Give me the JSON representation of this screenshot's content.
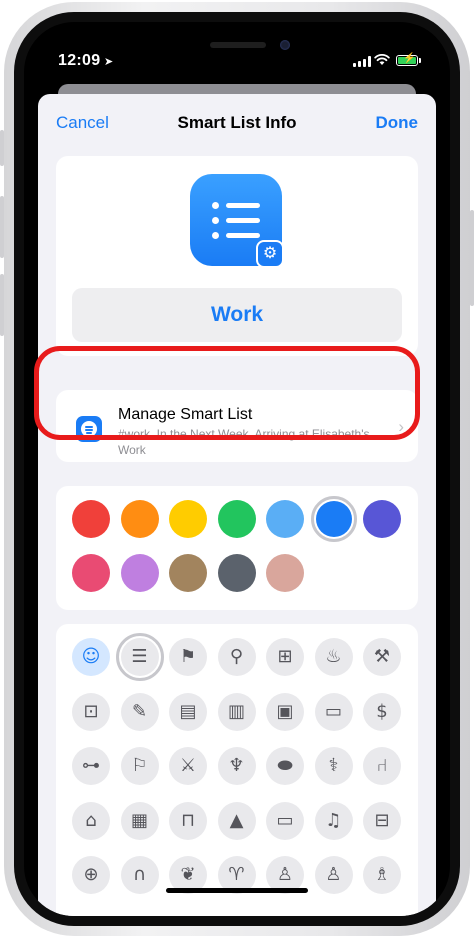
{
  "status_bar": {
    "time": "12:09",
    "location_icon": "location-arrow-icon",
    "battery_color": "#31d158"
  },
  "nav": {
    "cancel_label": "Cancel",
    "title": "Smart List Info",
    "done_label": "Done"
  },
  "list": {
    "name": "Work",
    "icon": "list-bullet-icon",
    "badge_icon": "gear-icon",
    "color": "#1a7cf5"
  },
  "manage": {
    "title": "Manage Smart List",
    "subtitle": "#work, In the Next Week, Arriving at Elisabeth's Work",
    "icon": "smart-list-icon"
  },
  "colors": {
    "selected": "blue",
    "swatches": [
      {
        "name": "red",
        "hex": "#f0403a"
      },
      {
        "name": "orange",
        "hex": "#ff8d12"
      },
      {
        "name": "yellow",
        "hex": "#ffcc00"
      },
      {
        "name": "green",
        "hex": "#22c55e"
      },
      {
        "name": "light-blue",
        "hex": "#5aaef5"
      },
      {
        "name": "blue",
        "hex": "#1a7cf5"
      },
      {
        "name": "indigo",
        "hex": "#5856d6"
      },
      {
        "name": "pink",
        "hex": "#e94b73"
      },
      {
        "name": "purple",
        "hex": "#bf7fe0"
      },
      {
        "name": "brown",
        "hex": "#a2845e"
      },
      {
        "name": "gray",
        "hex": "#5b626c"
      },
      {
        "name": "rose",
        "hex": "#d9a69c"
      }
    ]
  },
  "icons": {
    "selected": "list-icon",
    "items": [
      {
        "name": "smiley-icon",
        "glyph": "☺"
      },
      {
        "name": "list-icon",
        "glyph": "☰"
      },
      {
        "name": "bookmark-icon",
        "glyph": "⚑"
      },
      {
        "name": "pin-icon",
        "glyph": "⚲"
      },
      {
        "name": "gift-icon",
        "glyph": "⊞"
      },
      {
        "name": "cake-icon",
        "glyph": "♨"
      },
      {
        "name": "graduation-cap-icon",
        "glyph": "⚒"
      },
      {
        "name": "backpack-icon",
        "glyph": "⊡"
      },
      {
        "name": "pencil-ruler-icon",
        "glyph": "✎"
      },
      {
        "name": "document-icon",
        "glyph": "▤"
      },
      {
        "name": "book-icon",
        "glyph": "▥"
      },
      {
        "name": "wallet-icon",
        "glyph": "▣"
      },
      {
        "name": "credit-card-icon",
        "glyph": "▭"
      },
      {
        "name": "money-icon",
        "glyph": "$"
      },
      {
        "name": "dumbbell-icon",
        "glyph": "⊶"
      },
      {
        "name": "runner-icon",
        "glyph": "⚐"
      },
      {
        "name": "fork-knife-icon",
        "glyph": "⚔"
      },
      {
        "name": "wine-glass-icon",
        "glyph": "♆"
      },
      {
        "name": "pills-icon",
        "glyph": "⬬"
      },
      {
        "name": "stethoscope-icon",
        "glyph": "⚕"
      },
      {
        "name": "chair-icon",
        "glyph": "⑁"
      },
      {
        "name": "house-icon",
        "glyph": "⌂"
      },
      {
        "name": "building-icon",
        "glyph": "▦"
      },
      {
        "name": "bank-icon",
        "glyph": "⊓"
      },
      {
        "name": "tent-icon",
        "glyph": "▲"
      },
      {
        "name": "tv-icon",
        "glyph": "▭"
      },
      {
        "name": "music-note-icon",
        "glyph": "♫"
      },
      {
        "name": "computer-icon",
        "glyph": "⊟"
      },
      {
        "name": "gamepad-icon",
        "glyph": "⊕"
      },
      {
        "name": "headphones-icon",
        "glyph": "∩"
      },
      {
        "name": "leaf-icon",
        "glyph": "❦"
      },
      {
        "name": "carrot-icon",
        "glyph": "♈"
      },
      {
        "name": "person-icon",
        "glyph": "♙"
      },
      {
        "name": "two-people-icon",
        "glyph": "♙"
      },
      {
        "name": "family-icon",
        "glyph": "♗"
      }
    ]
  }
}
